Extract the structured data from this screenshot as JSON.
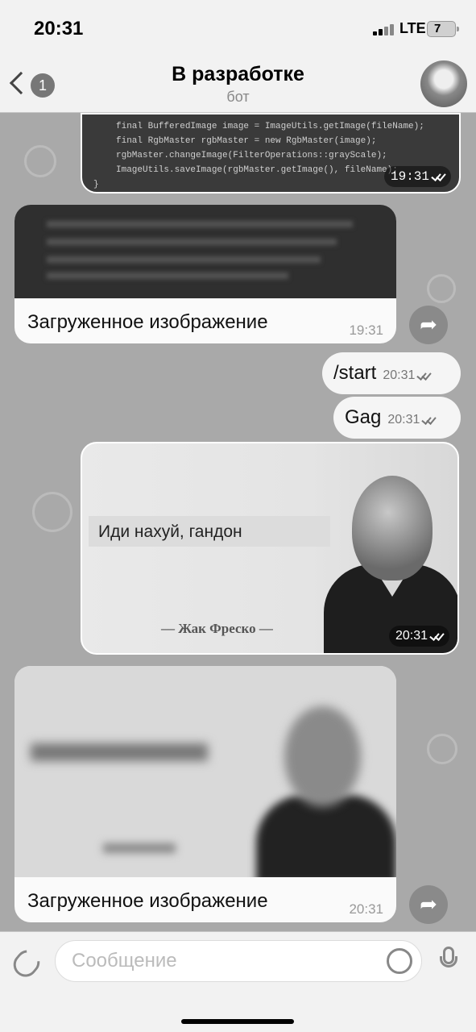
{
  "status_bar": {
    "time": "20:31",
    "network": "LTE",
    "battery": "7"
  },
  "header": {
    "back_badge": "1",
    "title": "В разработке",
    "subtitle": "бот"
  },
  "messages": {
    "code": {
      "lines": [
        "final BufferedImage image = ImageUtils.getImage(fileName);",
        "final RgbMaster rgbMaster = new RgbMaster(image);",
        "rgbMaster.changeImage(FilterOperations::grayScale);",
        "ImageUtils.saveImage(rgbMaster.getImage(), fileName);",
        "}"
      ],
      "time": "19:31"
    },
    "image_1": {
      "caption": "Загруженное изображение",
      "time": "19:31"
    },
    "start": {
      "text": "/start",
      "time": "20:31"
    },
    "gag": {
      "text": "Gag",
      "time": "20:31"
    },
    "meme": {
      "text": "Иди нахуй, гандон",
      "author": "— Жак Фреско —",
      "time": "20:31"
    },
    "image_2": {
      "caption": "Загруженное изображение",
      "time": "20:31"
    }
  },
  "input": {
    "placeholder": "Сообщение"
  },
  "icons": {
    "back": "chevron-left-icon",
    "share": "share-icon",
    "attach": "paperclip-icon",
    "sticker": "sticker-icon",
    "mic": "microphone-icon"
  }
}
